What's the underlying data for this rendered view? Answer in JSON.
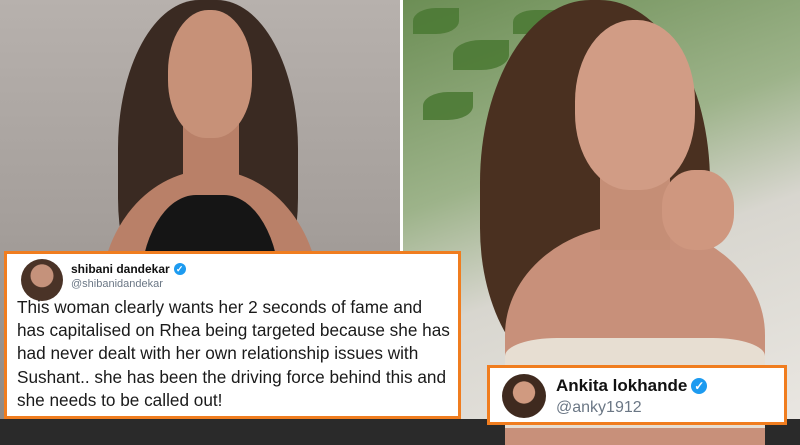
{
  "tweets": [
    {
      "name": "shibani dandekar",
      "handle": "@shibanidandekar",
      "lines": [
        "This woman clearly wants her 2 seconds of fame and",
        "has capitalised on Rhea being targeted because she has",
        "had never dealt with her own relationship issues with",
        "Sushant.. she has been the driving force behind this and",
        "she needs to be called out!"
      ],
      "verified_icon": "verified-badge-icon"
    },
    {
      "name": "Ankita lokhande",
      "handle": "@anky1912",
      "verified_icon": "verified-badge-icon"
    }
  ],
  "colors": {
    "card_border": "#f07d1f",
    "verified": "#1d9bf0",
    "handle_text": "#6b7785"
  }
}
